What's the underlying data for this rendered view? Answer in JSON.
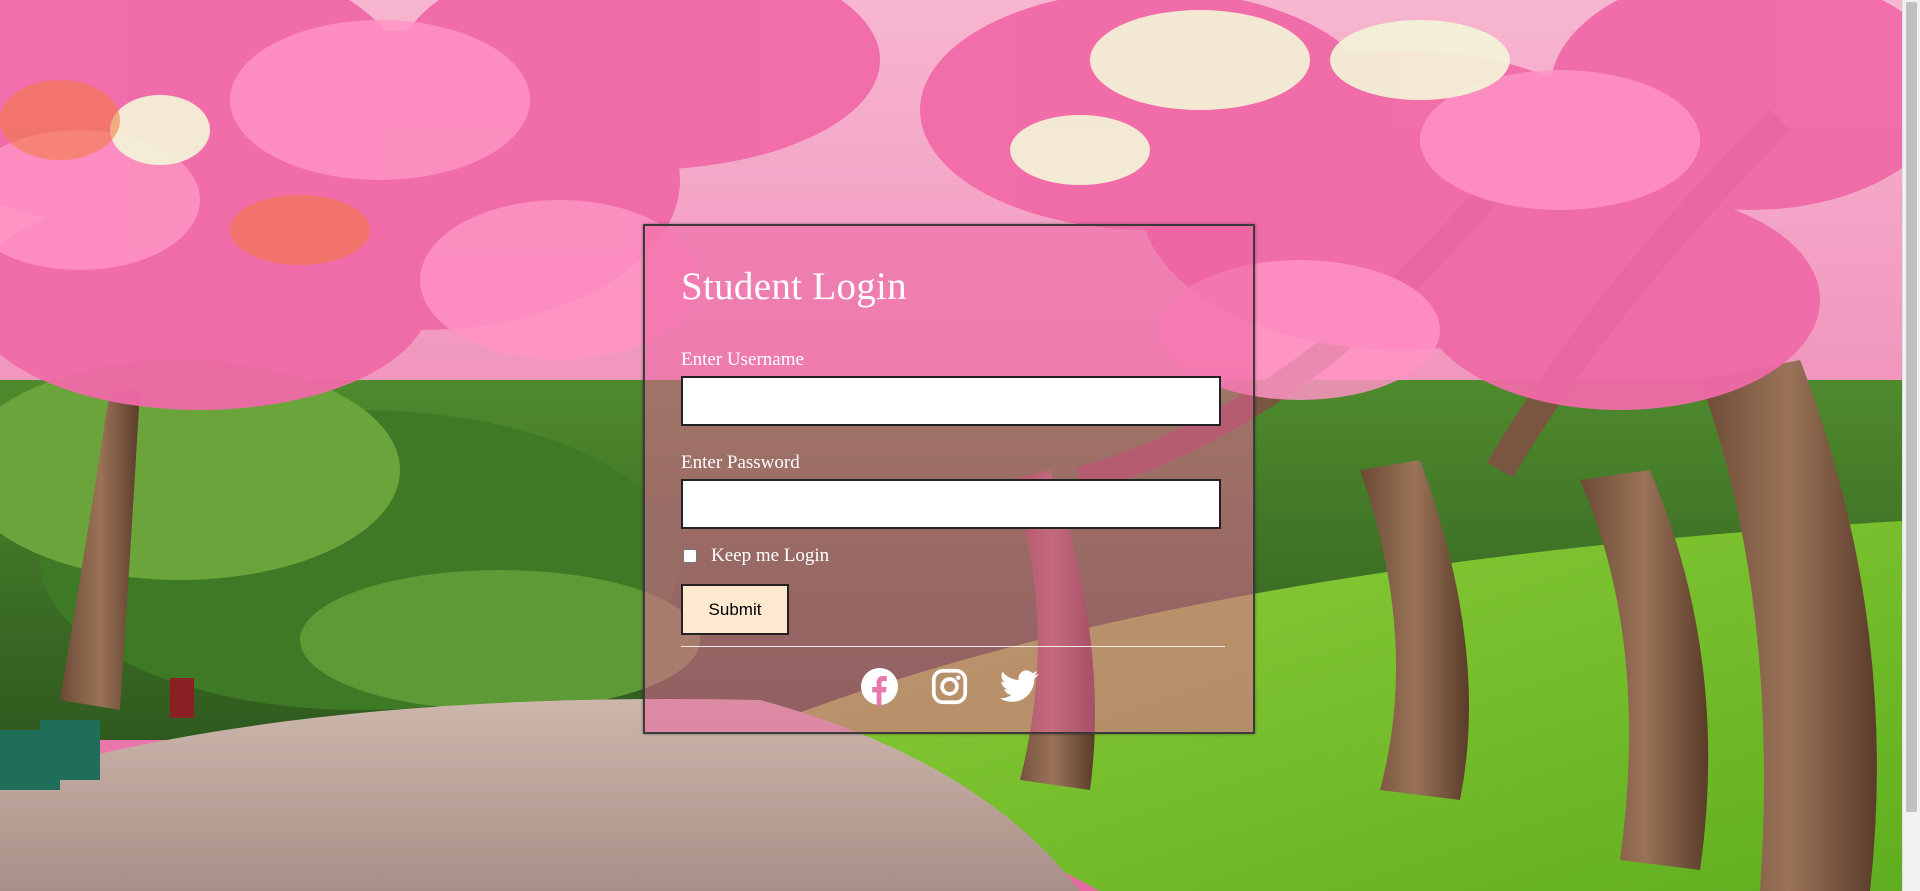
{
  "login": {
    "title": "Student Login",
    "username_label": "Enter Username",
    "username_value": "",
    "password_label": "Enter Password",
    "password_value": "",
    "remember_label": "Keep me Login",
    "remember_checked": false,
    "submit_label": "Submit"
  },
  "social": [
    {
      "name": "facebook-icon"
    },
    {
      "name": "instagram-icon"
    },
    {
      "name": "twitter-icon"
    }
  ],
  "colors": {
    "panel_overlay": "#ec62a0",
    "button_bg": "#fde9cf",
    "text": "#ffffff"
  }
}
